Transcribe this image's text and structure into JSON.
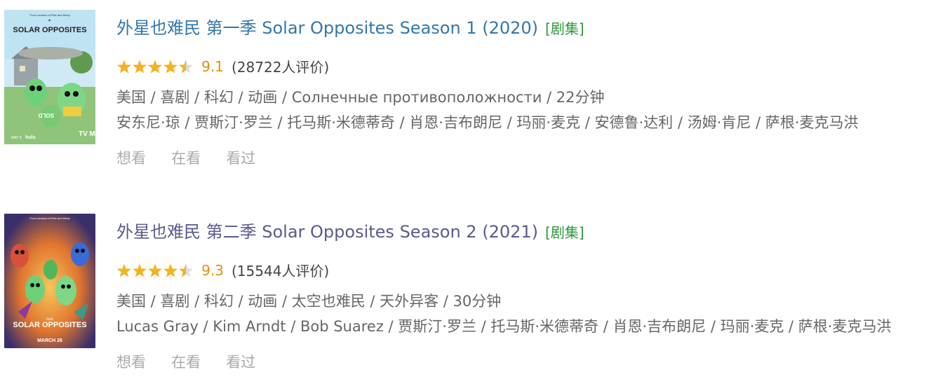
{
  "results": [
    {
      "poster": {
        "poster_title": "SOLAR OPPOSITES",
        "top_text": "From creators of Rick and Morty",
        "network": "hulu",
        "date_text": "MAY 8",
        "rating_badge": "TV MA",
        "colors": {
          "sky": "#bfe3f2",
          "grass": "#8fc47a",
          "alien": "#6fd07a",
          "house": "#9aa3a8"
        }
      },
      "title": "外星也难民 第一季 Solar Opposites Season 1 (2020)",
      "category": "[剧集]",
      "rating": {
        "stars_fraction": 0.9,
        "score": "9.1",
        "count": "(28722人评价)"
      },
      "meta_line": "美国 / 喜剧 / 科幻 / 动画 / Солнечные противоположности / 22分钟",
      "cast_line": "安东尼·琼 / 贾斯汀·罗兰 / 托马斯·米德蒂奇 / 肖恩·吉布朗尼 / 玛丽·麦克 / 安德鲁·达利 / 汤姆·肯尼 / 萨根·麦克马洪",
      "actions": [
        "想看",
        "在看",
        "看过"
      ]
    },
    {
      "poster": {
        "poster_title": "SOLAR OPPOSITES",
        "top_text": "From creators of Rick and Morty",
        "network": "hulu",
        "date_text": "MARCH 26",
        "colors": {
          "sky": "#3a2f6b",
          "glow": "#f2a23a",
          "alien": "#6fd07a",
          "red": "#d9503a"
        }
      },
      "title": "外星也难民 第二季 Solar Opposites Season 2 (2021)",
      "category": "[剧集]",
      "rating": {
        "stars_fraction": 0.9,
        "score": "9.3",
        "count": "(15544人评价)"
      },
      "meta_line": "美国 / 喜剧 / 科幻 / 动画 / 太空也难民 / 天外异客 / 30分钟",
      "cast_line": "Lucas Gray / Kim Arndt / Bob Suarez / 贾斯汀·罗兰 / 托马斯·米德蒂奇 / 肖恩·吉布朗尼 / 玛丽·麦克 / 萨根·麦克马洪",
      "actions": [
        "想看",
        "在看",
        "看过"
      ]
    }
  ],
  "colors": {
    "title_link": "#3377aa",
    "category": "#2e963d",
    "star": "#f5b31c",
    "star_empty": "#dddddd",
    "rating_num": "#e09015",
    "meta_text": "#666666",
    "action_text": "#aaaaaa"
  },
  "icons": {
    "star": "star-icon"
  }
}
